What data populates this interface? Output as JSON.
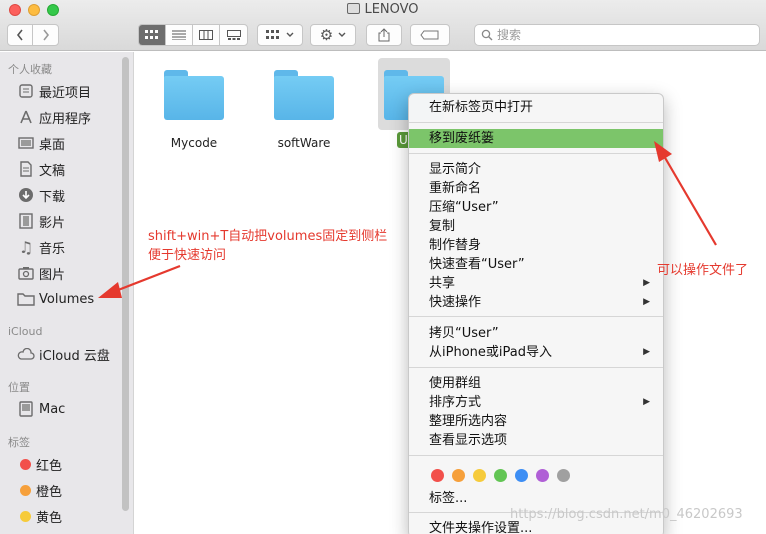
{
  "window": {
    "title": "LENOVO"
  },
  "toolbar": {
    "back_icon": "chevron-left-icon",
    "forward_icon": "chevron-right-icon",
    "search_placeholder": "搜索"
  },
  "sidebar": {
    "sections": {
      "favorites": "个人收藏",
      "icloud": "iCloud",
      "locations": "位置",
      "tags": "标签"
    },
    "favorites": [
      {
        "label": "最近项目",
        "icon": "recents-icon"
      },
      {
        "label": "应用程序",
        "icon": "applications-icon"
      },
      {
        "label": "桌面",
        "icon": "desktop-icon"
      },
      {
        "label": "文稿",
        "icon": "documents-icon"
      },
      {
        "label": "下载",
        "icon": "downloads-icon"
      },
      {
        "label": "影片",
        "icon": "movies-icon"
      },
      {
        "label": "音乐",
        "icon": "music-icon"
      },
      {
        "label": "图片",
        "icon": "pictures-icon"
      },
      {
        "label": "Volumes",
        "icon": "folder-icon"
      }
    ],
    "icloud_items": [
      {
        "label": "iCloud 云盘",
        "icon": "cloud-icon"
      }
    ],
    "locations": [
      {
        "label": "Mac",
        "icon": "mac-icon"
      }
    ],
    "tags": [
      {
        "label": "红色",
        "color": "#f2504b"
      },
      {
        "label": "橙色",
        "color": "#f6a03b"
      },
      {
        "label": "黄色",
        "color": "#f6cb3b"
      }
    ]
  },
  "content": {
    "folders": [
      {
        "name": "Mycode"
      },
      {
        "name": "softWare"
      }
    ],
    "selected_folder_label": "U"
  },
  "menu": {
    "items": [
      "在新标签页中打开",
      "移到废纸篓",
      "显示简介",
      "重新命名",
      "压缩“User”",
      "复制",
      "制作替身",
      "快速查看“User”",
      "共享",
      "快速操作",
      "拷贝“User”",
      "从iPhone或iPad导入",
      "使用群组",
      "排序方式",
      "整理所选内容",
      "查看显示选项",
      "标签...",
      "文件夹操作设置..."
    ],
    "tag_colors": [
      "#f2504b",
      "#f6a03b",
      "#f6cb3b",
      "#62c554",
      "#3d8ef4",
      "#b05fd6",
      "#a0a0a0"
    ]
  },
  "annotations": {
    "left_note_line1": "shift+win+T自动把volumes固定到侧栏",
    "left_note_line2": "便于快速访问",
    "right_note": "可以操作文件了",
    "accent": "#e5392e"
  },
  "watermark": "https://blog.csdn.net/m0_46202693"
}
